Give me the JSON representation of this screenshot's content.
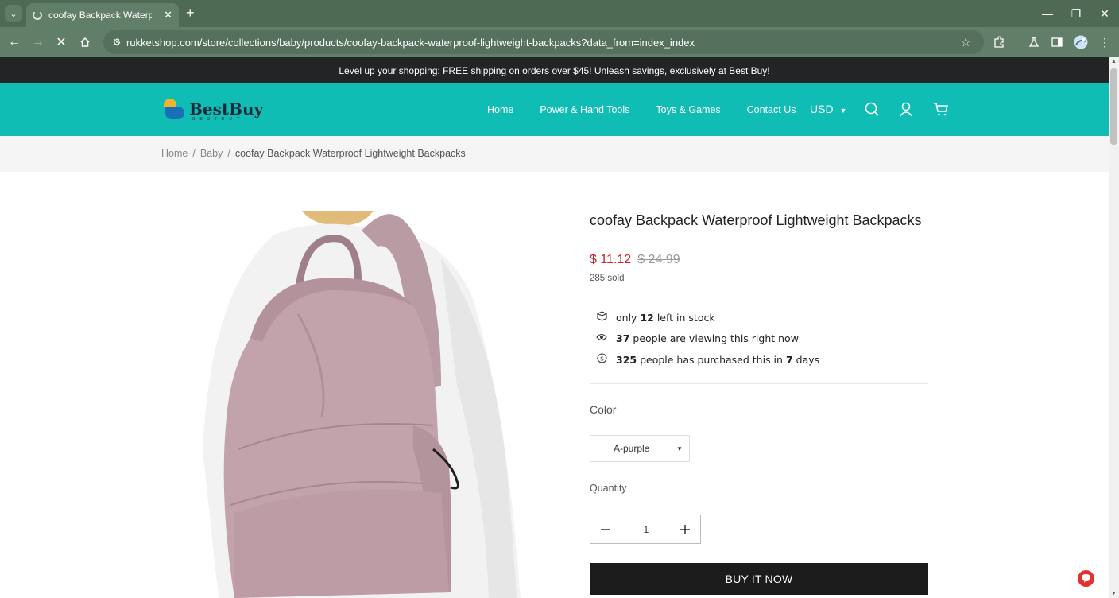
{
  "browser": {
    "tab_title": "coofay Backpack Waterproof Li",
    "url": "rukketshop.com/store/collections/baby/products/coofay-backpack-waterproof-lightweight-backpacks?data_from=index_index"
  },
  "announcement": "Level up your shopping: FREE shipping on orders over $45! Unleash savings, exclusively at Best Buy!",
  "header": {
    "logo_text": "BestBuy",
    "logo_sub": "BESTBUY",
    "nav": [
      "Home",
      "Power & Hand Tools",
      "Toys & Games",
      "Contact Us"
    ],
    "currency": "USD"
  },
  "breadcrumb": [
    "Home",
    "Baby",
    "coofay Backpack Waterproof Lightweight Backpacks"
  ],
  "product": {
    "title": "coofay Backpack Waterproof Lightweight Backpacks",
    "price": "$ 11.12",
    "old_price": "$ 24.99",
    "sold": "285 sold",
    "stock": {
      "pre": "only",
      "count": "12",
      "post": "left in stock"
    },
    "viewing": {
      "count": "37",
      "post": "people are viewing this right now"
    },
    "purchased": {
      "count": "325",
      "mid": "people has purchased this in",
      "days": "7",
      "post": "days"
    },
    "color_label": "Color",
    "color_value": "A-purple",
    "quantity_label": "Quantity",
    "quantity": "1",
    "buy_label": "BUY IT NOW"
  },
  "colors": {
    "header": "#10bdb5",
    "announce": "#222426",
    "price": "#d0202a",
    "chrome": "#617e68"
  }
}
